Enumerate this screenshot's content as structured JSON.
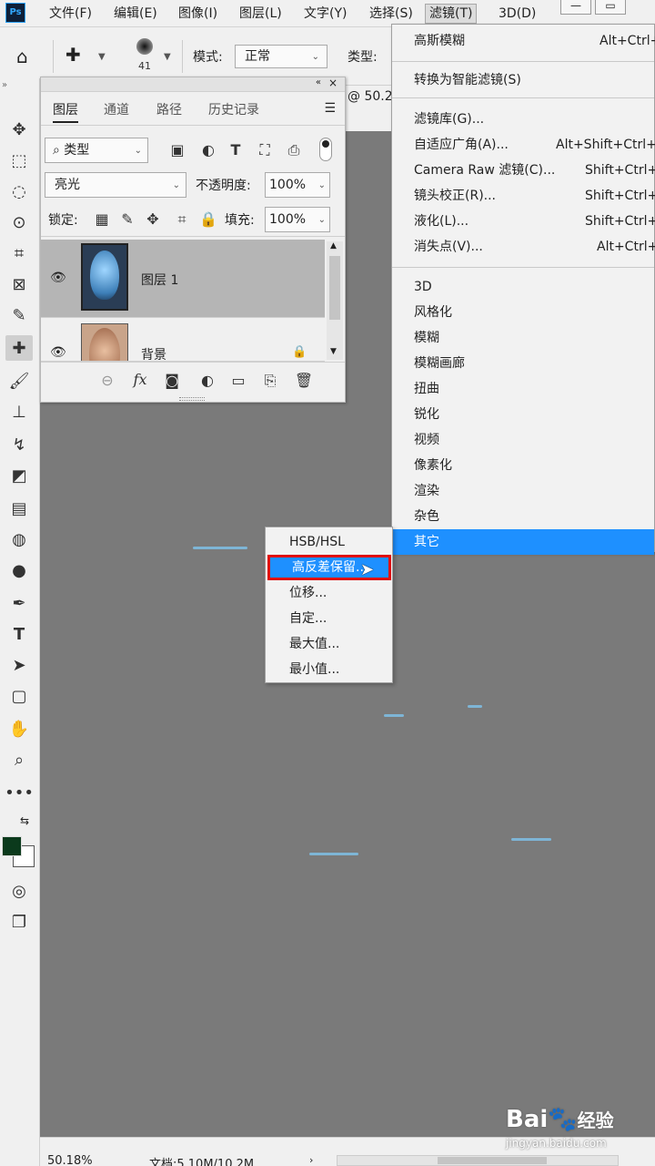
{
  "menubar": {
    "logo": "Ps",
    "items": [
      "文件(F)",
      "编辑(E)",
      "图像(I)",
      "图层(L)",
      "文字(Y)",
      "选择(S)",
      "滤镜(T)",
      "3D(D)"
    ],
    "win_minimize": "—",
    "win_restore": "▭"
  },
  "options": {
    "brush_size": "41",
    "mode_label": "模式:",
    "mode_value": "正常",
    "type_label": "类型:"
  },
  "doc": {
    "zoom_fragment": "@ 50.2"
  },
  "layers_panel": {
    "tabs": [
      "图层",
      "通道",
      "路径",
      "历史记录"
    ],
    "filter_kind": "类型",
    "blend_mode": "亮光",
    "opacity_label": "不透明度:",
    "opacity_value": "100%",
    "lock_label": "锁定:",
    "fill_label": "填充:",
    "fill_value": "100%",
    "layers": [
      {
        "name": "图层 1",
        "selected": true
      },
      {
        "name": "背景",
        "selected": false
      }
    ],
    "footer_fx": "fx"
  },
  "filter_menu": {
    "items": [
      {
        "label": "高斯模糊",
        "shortcut": "Alt+Ctrl+"
      },
      {
        "label": "转换为智能滤镜(S)",
        "shortcut": ""
      },
      {
        "label": "滤镜库(G)...",
        "shortcut": ""
      },
      {
        "label": "自适应广角(A)...",
        "shortcut": "Alt+Shift+Ctrl+"
      },
      {
        "label": "Camera Raw 滤镜(C)...",
        "shortcut": "Shift+Ctrl+"
      },
      {
        "label": "镜头校正(R)...",
        "shortcut": "Shift+Ctrl+"
      },
      {
        "label": "液化(L)...",
        "shortcut": "Shift+Ctrl+"
      },
      {
        "label": "消失点(V)...",
        "shortcut": "Alt+Ctrl+"
      },
      {
        "label": "3D",
        "shortcut": ""
      },
      {
        "label": "风格化",
        "shortcut": ""
      },
      {
        "label": "模糊",
        "shortcut": ""
      },
      {
        "label": "模糊画廊",
        "shortcut": ""
      },
      {
        "label": "扭曲",
        "shortcut": ""
      },
      {
        "label": "锐化",
        "shortcut": ""
      },
      {
        "label": "视频",
        "shortcut": ""
      },
      {
        "label": "像素化",
        "shortcut": ""
      },
      {
        "label": "渲染",
        "shortcut": ""
      },
      {
        "label": "杂色",
        "shortcut": ""
      },
      {
        "label": "其它",
        "shortcut": ""
      }
    ]
  },
  "submenu": {
    "items": [
      "HSB/HSL",
      "高反差保留...",
      "位移...",
      "自定...",
      "最大值...",
      "最小值..."
    ]
  },
  "status": {
    "zoom": "50.18%",
    "doc": "文档:5.10M/10.2M"
  },
  "watermark": {
    "brand": "Bai",
    "brand2": "经验",
    "url": "jingyan.baidu.com"
  },
  "colors": {
    "highlight": "#1e90ff",
    "highlight_border": "#e01010",
    "foreground": "#0b3a1c",
    "background": "#ffffff"
  }
}
